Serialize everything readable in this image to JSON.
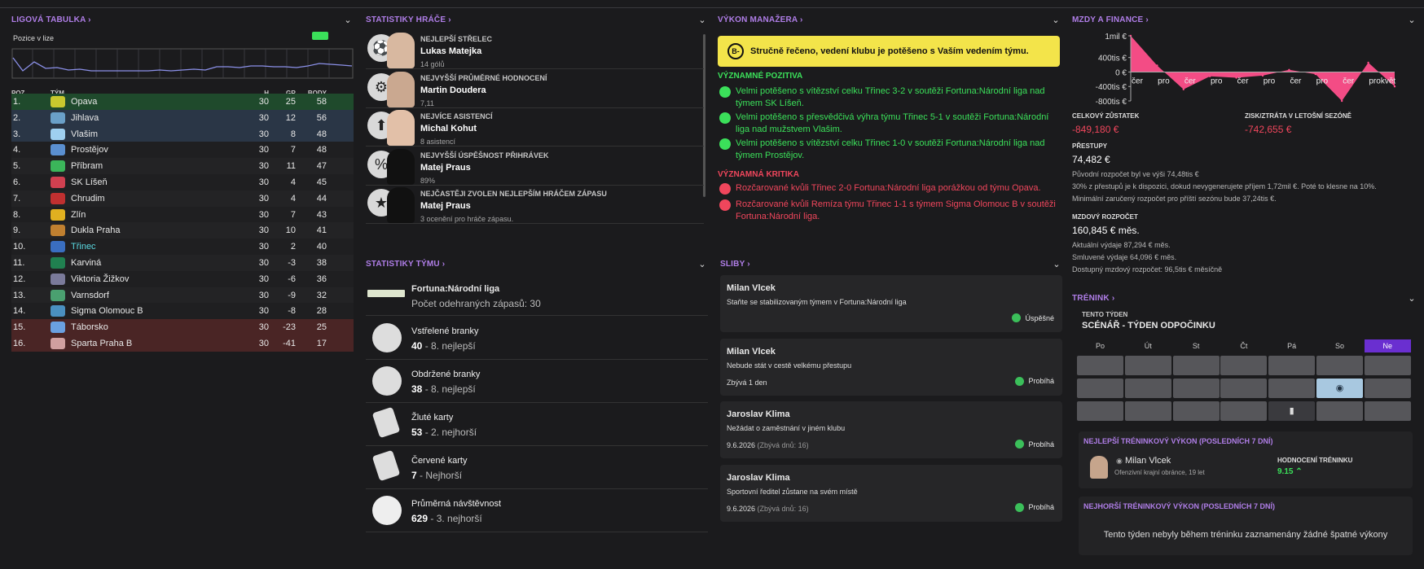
{
  "league": {
    "title": "LIGOVÁ TABULKA",
    "pos_label": "Pozice v lize",
    "cols": {
      "pos": "POZ",
      "team": "TÝM",
      "played": "H",
      "gd": "GR",
      "pts": "BODY"
    },
    "rows": [
      {
        "pos": "1.",
        "team": "Opava",
        "p": "30",
        "gd": "25",
        "pts": "58"
      },
      {
        "pos": "2.",
        "team": "Jihlava",
        "p": "30",
        "gd": "12",
        "pts": "56"
      },
      {
        "pos": "3.",
        "team": "Vlašim",
        "p": "30",
        "gd": "8",
        "pts": "48"
      },
      {
        "pos": "4.",
        "team": "Prostějov",
        "p": "30",
        "gd": "7",
        "pts": "48"
      },
      {
        "pos": "5.",
        "team": "Příbram",
        "p": "30",
        "gd": "11",
        "pts": "47"
      },
      {
        "pos": "6.",
        "team": "SK Líšeň",
        "p": "30",
        "gd": "4",
        "pts": "45"
      },
      {
        "pos": "7.",
        "team": "Chrudim",
        "p": "30",
        "gd": "4",
        "pts": "44"
      },
      {
        "pos": "8.",
        "team": "Zlín",
        "p": "30",
        "gd": "7",
        "pts": "43"
      },
      {
        "pos": "9.",
        "team": "Dukla Praha",
        "p": "30",
        "gd": "10",
        "pts": "41"
      },
      {
        "pos": "10.",
        "team": "Třinec",
        "p": "30",
        "gd": "2",
        "pts": "40"
      },
      {
        "pos": "11.",
        "team": "Karviná",
        "p": "30",
        "gd": "-3",
        "pts": "38"
      },
      {
        "pos": "12.",
        "team": "Viktoria Žižkov",
        "p": "30",
        "gd": "-6",
        "pts": "36"
      },
      {
        "pos": "13.",
        "team": "Varnsdorf",
        "p": "30",
        "gd": "-9",
        "pts": "32"
      },
      {
        "pos": "14.",
        "team": "Sigma Olomouc B",
        "p": "30",
        "gd": "-8",
        "pts": "28"
      },
      {
        "pos": "15.",
        "team": "Táborsko",
        "p": "30",
        "gd": "-23",
        "pts": "25"
      },
      {
        "pos": "16.",
        "team": "Sparta Praha B",
        "p": "30",
        "gd": "-41",
        "pts": "17"
      }
    ]
  },
  "player_stats": {
    "title": "STATISTIKY HRÁČE",
    "items": [
      {
        "label": "NEJLEPŠÍ STŘELEC",
        "name": "Lukas Matejka",
        "sub": "14 gólů"
      },
      {
        "label": "NEJVYŠŠÍ PRŮMĚRNÉ HODNOCENÍ",
        "name": "Martin Doudera",
        "sub": "7,11"
      },
      {
        "label": "NEJVÍCE ASISTENCÍ",
        "name": "Michal Kohut",
        "sub": "8 asistencí"
      },
      {
        "label": "NEJVYŠŠÍ ÚSPĚŠNOST PŘIHRÁVEK",
        "name": "Matej Praus",
        "sub": "89%"
      },
      {
        "label": "NEJČASTĚJI ZVOLEN NEJLEPŠÍM HRÁČEM ZÁPASU",
        "name": "Matej Praus",
        "sub": "3 ocenění pro hráče zápasu."
      }
    ]
  },
  "team_stats": {
    "title": "STATISTIKY TÝMU",
    "league": "Fortuna:Národní liga",
    "matches": "Počet odehraných zápasů: 30",
    "items": [
      {
        "label": "Vstřelené branky",
        "val": "40",
        "rank": " - 8. nejlepší"
      },
      {
        "label": "Obdržené branky",
        "val": "38",
        "rank": " - 8. nejlepší"
      },
      {
        "label": "Žluté karty",
        "val": "53",
        "rank": " - 2. nejhorší"
      },
      {
        "label": "Červené karty",
        "val": "7",
        "rank": " - Nejhorší"
      },
      {
        "label": "Průměrná návštěvnost",
        "val": "629",
        "rank": " - 3. nejhorší"
      }
    ]
  },
  "manager": {
    "title": "VÝKON MANAŽERA",
    "grade": "B-",
    "mood": "Stručně řečeno, vedení klubu je potěšeno s Vaším vedením týmu.",
    "pos_title": "VÝZNAMNÉ POZITIVA",
    "positives": [
      "Velmi potěšeno s vítězství celku Třinec 3-2 v soutěži Fortuna:Národní liga nad týmem SK Líšeň.",
      "Velmi potěšeno s přesvědčivá výhra týmu Třinec 5-1 v soutěži Fortuna:Národní liga nad mužstvem Vlašim.",
      "Velmi potěšeno s vítězství celku Třinec 1-0 v soutěži Fortuna:Národní liga nad týmem Prostějov."
    ],
    "neg_title": "VÝZNAMNÁ KRITIKA",
    "negatives": [
      "Rozčarované kvůli Třinec 2-0 Fortuna:Národní liga porážkou od týmu Opava.",
      "Rozčarované kvůli Remíza týmu Třinec 1-1 s týmem Sigma Olomouc B v soutěži Fortuna:Národní liga."
    ],
    "colors": {
      "positive": "#3be05a",
      "negative": "#f0465c",
      "mood": "#f3e44a"
    }
  },
  "promises": {
    "title": "SLIBY",
    "items": [
      {
        "who": "Milan Vlcek",
        "what": "Staňte se stabilizovaným týmem v Fortuna:Národní liga",
        "when": "",
        "rem": "",
        "status": "Úspěšné"
      },
      {
        "who": "Milan Vlcek",
        "what": "Nebude stát v cestě velkému přestupu",
        "when": "Zbývá 1 den",
        "rem": "",
        "status": "Probíhá"
      },
      {
        "who": "Jaroslav Klima",
        "what": "Nežádat o zaměstnání v jiném klubu",
        "when": "9.6.2026",
        "rem": " (Zbývá dnů: 16)",
        "status": "Probíhá"
      },
      {
        "who": "Jaroslav Klima",
        "what": "Sportovní ředitel zůstane na svém místě",
        "when": "9.6.2026",
        "rem": " (Zbývá dnů: 16)",
        "status": "Probíhá"
      }
    ]
  },
  "finance": {
    "title": "MZDY A FINANCE",
    "y_ticks": [
      "1mil €",
      "400tis €",
      "0 €",
      "-400tis €",
      "-800tis €"
    ],
    "x_ticks": [
      "čer",
      "pro",
      "čer",
      "pro",
      "čer",
      "pro",
      "čer",
      "pro",
      "čer",
      "pro",
      "květ"
    ],
    "chart_data": {
      "type": "area",
      "x": [
        "čer",
        "pro",
        "čer",
        "pro",
        "čer",
        "pro",
        "čer",
        "pro",
        "čer",
        "pro",
        "květ"
      ],
      "series": [
        {
          "values": [
            1000000,
            180000,
            -480000,
            -120000,
            -160000,
            -100000,
            60000,
            -60000,
            -800000,
            260000,
            -400000
          ]
        }
      ],
      "ylim": [
        -800000,
        1000000
      ],
      "color": "#ff4f8b"
    },
    "balance_label": "CELKOVÝ ZŮSTATEK",
    "balance": "-849,180 €",
    "season_label": "ZISK/ZTRÁTA V LETOŠNÍ SEZÓNĚ",
    "season": "-742,655 €",
    "transfers_label": "PŘESTUPY",
    "transfers": "74,482 €",
    "transfers_notes": [
      "Původní rozpočet byl ve výši 74,48tis €",
      "30% z přestupů je k dispozici, dokud nevygenerujete příjem 1,72mil €. Poté to klesne na 10%.",
      "Minimální zaručený rozpočet pro příští sezónu bude 37,24tis €."
    ],
    "wage_label": "MZDOVÝ ROZPOČET",
    "wage": "160,845 € měs.",
    "wage_notes": [
      "Aktuální výdaje 87,294 € měs.",
      "Smluvené výdaje 64,096 € měs.",
      "Dostupný mzdový rozpočet: 96,5tis € měsíčně"
    ]
  },
  "training": {
    "title": "TRÉNINK",
    "week_label": "TENTO TÝDEN",
    "scenario": "SCÉNÁŘ - TÝDEN ODPOČINKU",
    "days": [
      "Po",
      "Út",
      "St",
      "Čt",
      "Pá",
      "So",
      "Ne"
    ],
    "best_title": "NEJLEPŠÍ TRÉNINKOVÝ VÝKON (POSLEDNÍCH 7 DNÍ)",
    "best_name": "Milan Vlcek",
    "best_role": "Ofenzivní krajní obránce, 19 let",
    "rating_label": "HODNOCENÍ TRÉNINKU",
    "rating": "9.15",
    "worst_title": "NEJHORŠÍ TRÉNINKOVÝ VÝKON (POSLEDNÍCH 7 DNÍ)",
    "worst_text": "Tento týden nebyly během tréninku zaznamenány žádné špatné výkony"
  }
}
